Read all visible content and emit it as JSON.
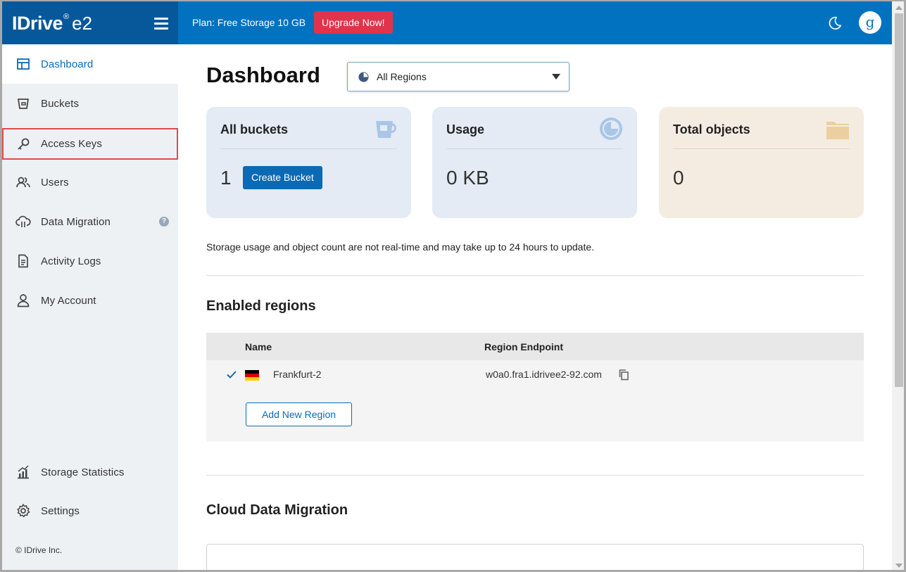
{
  "header": {
    "logo_text": "IDrive",
    "logo_reg": "®",
    "logo_suffix": "e2",
    "plan_text": "Plan: Free Storage 10 GB",
    "upgrade_label": "Upgrade Now!",
    "avatar_letter": "g",
    "brand_color": "#0172c0",
    "upgrade_color": "#e0344b"
  },
  "sidebar": {
    "items": [
      {
        "label": "Dashboard",
        "icon": "dashboard-icon",
        "active": true
      },
      {
        "label": "Buckets",
        "icon": "bucket-icon"
      },
      {
        "label": "Access Keys",
        "icon": "key-icon",
        "highlighted": true
      },
      {
        "label": "Users",
        "icon": "users-icon"
      },
      {
        "label": "Data Migration",
        "icon": "cloud-migration-icon",
        "help": "?"
      },
      {
        "label": "Activity Logs",
        "icon": "document-icon"
      },
      {
        "label": "My Account",
        "icon": "user-icon"
      },
      {
        "label": "Storage Statistics",
        "icon": "chart-icon"
      },
      {
        "label": "Settings",
        "icon": "gear-icon"
      }
    ],
    "copyright": "© IDrive Inc."
  },
  "main": {
    "title": "Dashboard",
    "region_select": {
      "value": "All Regions"
    },
    "cards": {
      "buckets": {
        "title": "All buckets",
        "value": "1",
        "button": "Create Bucket"
      },
      "usage": {
        "title": "Usage",
        "value": "0 KB"
      },
      "objects": {
        "title": "Total objects",
        "value": "0"
      }
    },
    "note": "Storage usage and object count are not real-time and may take up to 24 hours to update.",
    "regions": {
      "title": "Enabled regions",
      "columns": [
        "Name",
        "Region Endpoint"
      ],
      "rows": [
        {
          "name": "Frankfurt-2",
          "endpoint": "w0a0.fra1.idrivee2-92.com",
          "flag": "germany-flag",
          "enabled": true
        }
      ],
      "add_button": "Add New Region"
    },
    "migration": {
      "title": "Cloud Data Migration"
    }
  }
}
